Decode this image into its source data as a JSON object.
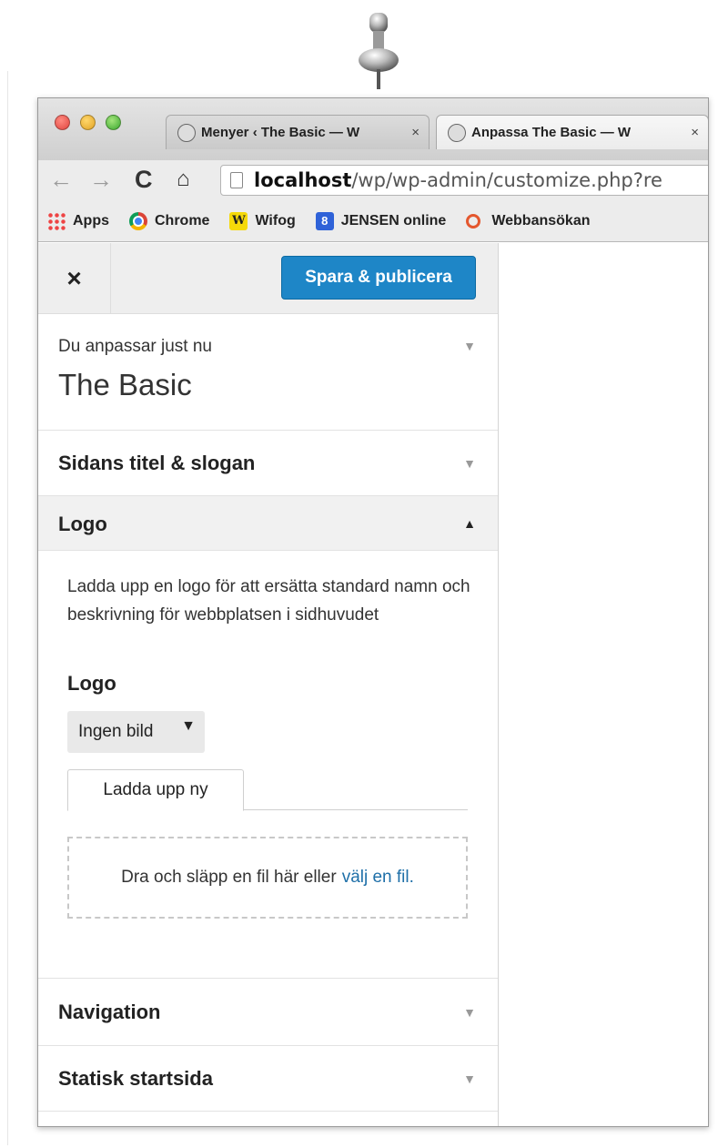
{
  "browser": {
    "tabs": [
      {
        "title": "Menyer ‹ The Basic — W",
        "close": "×"
      },
      {
        "title": "Anpassa The Basic — W",
        "close": "×"
      }
    ],
    "url": {
      "host": "localhost",
      "path": "/wp/wp-admin/customize.php?re"
    },
    "bookmarks": [
      {
        "label": "Apps",
        "icon": "apps-grid-icon"
      },
      {
        "label": "Chrome",
        "icon": "chrome-icon"
      },
      {
        "label": "Wifog",
        "icon": "wifog-icon",
        "glyph": "W"
      },
      {
        "label": "JENSEN online",
        "icon": "jensen-icon",
        "glyph": "8"
      },
      {
        "label": "Webbansökan",
        "icon": "webbansokan-icon"
      }
    ]
  },
  "customizer": {
    "close_label": "×",
    "publish_label": "Spara & publicera",
    "info": {
      "subtitle": "Du anpassar just nu",
      "title": "The Basic"
    },
    "sections": [
      {
        "title": "Sidans titel & slogan",
        "arrow": "▼"
      },
      {
        "title": "Logo",
        "arrow": "▲"
      },
      {
        "title": "Navigation",
        "arrow": "▼"
      },
      {
        "title": "Statisk startsida",
        "arrow": "▼"
      }
    ],
    "logo": {
      "description": "Ladda upp en logo för att ersätta standard namn och beskrivning för webbplatsen i sidhuvudet",
      "label": "Logo",
      "select_value": "Ingen bild",
      "upload_tab": "Ladda upp ny",
      "dropzone_text": "Dra och släpp en fil här eller",
      "dropzone_link": "välj en fil."
    }
  }
}
